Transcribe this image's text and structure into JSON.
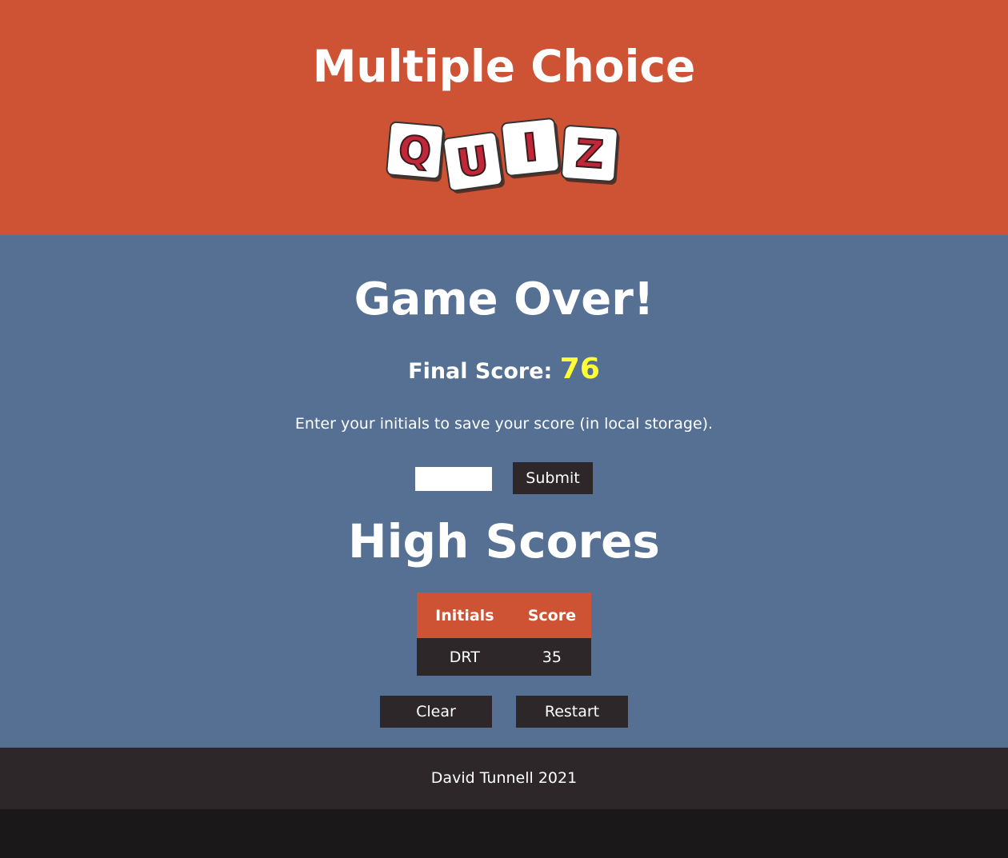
{
  "header": {
    "title": "Multiple Choice",
    "logo_letters": [
      "Q",
      "U",
      "I",
      "Z"
    ],
    "background": "#cd5334"
  },
  "game_over": {
    "title": "Game Over!",
    "final_score_label": "Final Score:",
    "final_score_value": "76",
    "score_color": "#ffff33",
    "instructions": "Enter your initials to save your score (in local storage).",
    "initials_value": "",
    "submit_label": "Submit"
  },
  "high_scores": {
    "title": "High Scores",
    "columns": [
      "Initials",
      "Score"
    ],
    "rows": [
      {
        "initials": "DRT",
        "score": "35"
      }
    ],
    "clear_label": "Clear",
    "restart_label": "Restart"
  },
  "footer": {
    "text": "David Tunnell 2021"
  },
  "colors": {
    "accent": "#cd5334",
    "main_bg": "#557093",
    "dark": "#2d2729"
  }
}
